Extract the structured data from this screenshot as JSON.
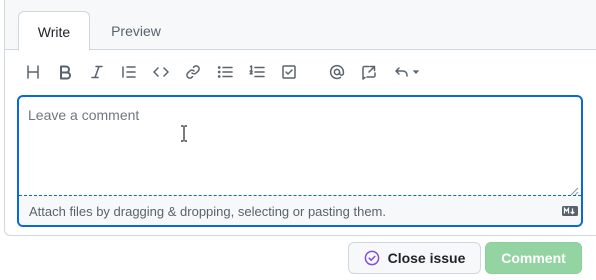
{
  "tabs": [
    {
      "label": "Write",
      "selected": true
    },
    {
      "label": "Preview",
      "selected": false
    }
  ],
  "toolbar": {
    "tools": [
      "heading-icon",
      "bold-icon",
      "italic-icon",
      "quote-icon",
      "code-icon",
      "link-icon",
      "bulleted-list-icon",
      "numbered-list-icon",
      "task-list-icon",
      "mention-icon",
      "reference-icon",
      "undo-icon"
    ]
  },
  "editor": {
    "placeholder": "Leave a comment",
    "value": "",
    "attach_hint": "Attach files by dragging & dropping, selecting or pasting them.",
    "markdown_icon": "markdown-icon"
  },
  "actions": {
    "close_issue_label": "Close issue",
    "comment_label": "Comment"
  },
  "colors": {
    "focus_border": "#0969da",
    "comment_button_bg": "#94d3a2",
    "close_icon": "#8250df"
  }
}
